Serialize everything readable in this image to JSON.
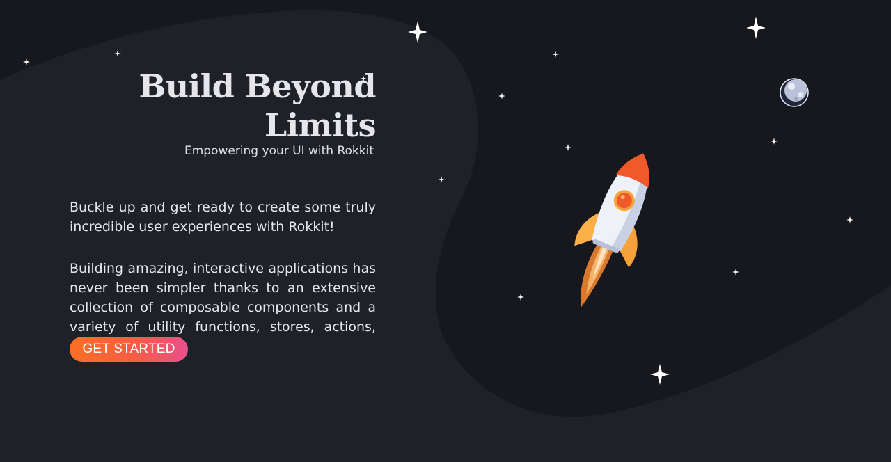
{
  "hero": {
    "title": "Build Beyond Limits",
    "subtitle": "Empowering your UI with Rokkit",
    "paragraph_1": "Buckle up and get ready to create some truly incredible user experiences with Rokkit!",
    "paragraph_2": "Building amazing, interactive applications has never been simpler thanks to an extensive collection of composable components and a variety of utility functions, stores, actions, and themes.",
    "cta_label": "GET STARTED"
  },
  "illustration": {
    "icons": [
      "rocket-icon",
      "planet-icon",
      "star-icon"
    ]
  },
  "colors": {
    "background": "#1f2129",
    "blob": "#17181d",
    "cta_start": "#fb6f24",
    "cta_end": "#ea4f8b",
    "rocket_orange": "#f05a2a",
    "rocket_flame": "#f7a84a"
  }
}
